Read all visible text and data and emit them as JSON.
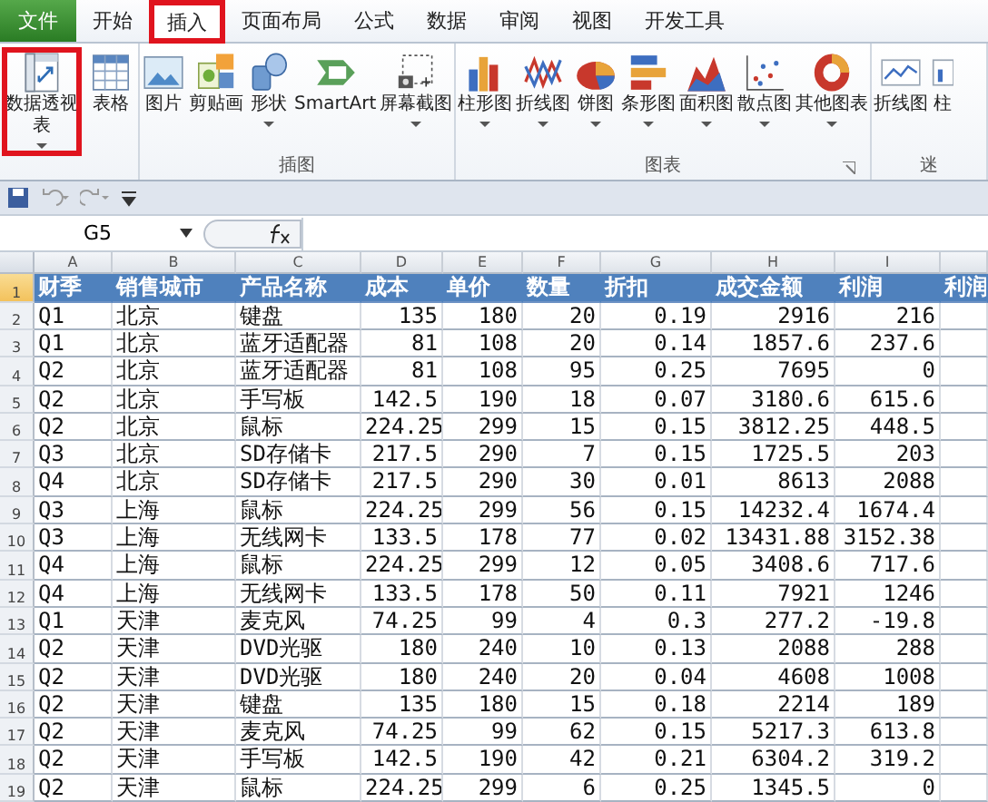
{
  "ribbon_tabs": [
    {
      "label": "文件",
      "kind": "file",
      "selected": false,
      "highlighted": false
    },
    {
      "label": "开始",
      "kind": "tab",
      "selected": false,
      "highlighted": false
    },
    {
      "label": "插入",
      "kind": "tab",
      "selected": true,
      "highlighted": true
    },
    {
      "label": "页面布局",
      "kind": "tab",
      "selected": false,
      "highlighted": false
    },
    {
      "label": "公式",
      "kind": "tab",
      "selected": false,
      "highlighted": false
    },
    {
      "label": "数据",
      "kind": "tab",
      "selected": false,
      "highlighted": false
    },
    {
      "label": "审阅",
      "kind": "tab",
      "selected": false,
      "highlighted": false
    },
    {
      "label": "视图",
      "kind": "tab",
      "selected": false,
      "highlighted": false
    },
    {
      "label": "开发工具",
      "kind": "tab",
      "selected": false,
      "highlighted": false
    }
  ],
  "ribbon_groups": [
    {
      "buttons": [
        {
          "label": "数据透视表",
          "has_menu": true,
          "highlighted": true
        },
        {
          "label": "表格",
          "has_menu": false,
          "highlighted": false
        }
      ]
    },
    {
      "label": "插图",
      "buttons": [
        {
          "label": "图片",
          "has_menu": false,
          "highlighted": false
        },
        {
          "label": "剪贴画",
          "has_menu": false,
          "highlighted": false
        },
        {
          "label": "形状",
          "has_menu": true,
          "highlighted": false
        },
        {
          "label": "SmartArt",
          "has_menu": false,
          "highlighted": false
        },
        {
          "label": "屏幕截图",
          "has_menu": true,
          "highlighted": false
        }
      ]
    },
    {
      "label": "图表",
      "launcher": true,
      "buttons": [
        {
          "label": "柱形图",
          "has_menu": true,
          "highlighted": false
        },
        {
          "label": "折线图",
          "has_menu": true,
          "highlighted": false
        },
        {
          "label": "饼图",
          "has_menu": true,
          "highlighted": false
        },
        {
          "label": "条形图",
          "has_menu": true,
          "highlighted": false
        },
        {
          "label": "面积图",
          "has_menu": true,
          "highlighted": false
        },
        {
          "label": "散点图",
          "has_menu": true,
          "highlighted": false
        },
        {
          "label": "其他图表",
          "has_menu": true,
          "highlighted": false
        }
      ]
    },
    {
      "label": "迷",
      "buttons": [
        {
          "label": "折线图",
          "has_menu": false,
          "highlighted": false
        },
        {
          "label": "柱",
          "has_menu": false,
          "highlighted": false
        }
      ]
    }
  ],
  "name_box": "G5",
  "columns": [
    {
      "letter": "A",
      "kind": "text"
    },
    {
      "letter": "B",
      "kind": "text"
    },
    {
      "letter": "C",
      "kind": "text"
    },
    {
      "letter": "D",
      "kind": "number"
    },
    {
      "letter": "E",
      "kind": "number"
    },
    {
      "letter": "F",
      "kind": "number"
    },
    {
      "letter": "G",
      "kind": "number"
    },
    {
      "letter": "H",
      "kind": "number"
    },
    {
      "letter": "I",
      "kind": "number"
    },
    {
      "kind": "number"
    }
  ],
  "rows": [
    {
      "number": "1",
      "selected": true,
      "header": true,
      "cells": [
        "财季",
        "销售城市",
        "产品名称",
        "成本",
        "单价",
        "数量",
        "折扣",
        "成交金额",
        "利润",
        "利润"
      ]
    },
    {
      "number": "2",
      "selected": false,
      "header": false,
      "cells": [
        "Q1",
        "北京",
        "键盘",
        "135",
        "180",
        "20",
        "0.19",
        "2916",
        "216"
      ]
    },
    {
      "number": "3",
      "selected": false,
      "header": false,
      "cells": [
        "Q1",
        "北京",
        "蓝牙适配器",
        "81",
        "108",
        "20",
        "0.14",
        "1857.6",
        "237.6"
      ]
    },
    {
      "number": "4",
      "selected": false,
      "header": false,
      "cells": [
        "Q2",
        "北京",
        "蓝牙适配器",
        "81",
        "108",
        "95",
        "0.25",
        "7695",
        "0"
      ]
    },
    {
      "number": "5",
      "selected": false,
      "header": false,
      "cells": [
        "Q2",
        "北京",
        "手写板",
        "142.5",
        "190",
        "18",
        "0.07",
        "3180.6",
        "615.6"
      ]
    },
    {
      "number": "6",
      "selected": false,
      "header": false,
      "cells": [
        "Q2",
        "北京",
        "鼠标",
        "224.25",
        "299",
        "15",
        "0.15",
        "3812.25",
        "448.5"
      ]
    },
    {
      "number": "7",
      "selected": false,
      "header": false,
      "cells": [
        "Q3",
        "北京",
        "SD存储卡",
        "217.5",
        "290",
        "7",
        "0.15",
        "1725.5",
        "203"
      ]
    },
    {
      "number": "8",
      "selected": false,
      "header": false,
      "cells": [
        "Q4",
        "北京",
        "SD存储卡",
        "217.5",
        "290",
        "30",
        "0.01",
        "8613",
        "2088"
      ]
    },
    {
      "number": "9",
      "selected": false,
      "header": false,
      "cells": [
        "Q3",
        "上海",
        "鼠标",
        "224.25",
        "299",
        "56",
        "0.15",
        "14232.4",
        "1674.4"
      ]
    },
    {
      "number": "10",
      "selected": false,
      "header": false,
      "cells": [
        "Q3",
        "上海",
        "无线网卡",
        "133.5",
        "178",
        "77",
        "0.02",
        "13431.88",
        "3152.38"
      ]
    },
    {
      "number": "11",
      "selected": false,
      "header": false,
      "cells": [
        "Q4",
        "上海",
        "鼠标",
        "224.25",
        "299",
        "12",
        "0.05",
        "3408.6",
        "717.6"
      ]
    },
    {
      "number": "12",
      "selected": false,
      "header": false,
      "cells": [
        "Q4",
        "上海",
        "无线网卡",
        "133.5",
        "178",
        "50",
        "0.11",
        "7921",
        "1246"
      ]
    },
    {
      "number": "13",
      "selected": false,
      "header": false,
      "cells": [
        "Q1",
        "天津",
        "麦克风",
        "74.25",
        "99",
        "4",
        "0.3",
        "277.2",
        "-19.8"
      ]
    },
    {
      "number": "14",
      "selected": false,
      "header": false,
      "cells": [
        "Q2",
        "天津",
        "DVD光驱",
        "180",
        "240",
        "10",
        "0.13",
        "2088",
        "288"
      ]
    },
    {
      "number": "15",
      "selected": false,
      "header": false,
      "cells": [
        "Q2",
        "天津",
        "DVD光驱",
        "180",
        "240",
        "20",
        "0.04",
        "4608",
        "1008"
      ]
    },
    {
      "number": "16",
      "selected": false,
      "header": false,
      "cells": [
        "Q2",
        "天津",
        "键盘",
        "135",
        "180",
        "15",
        "0.18",
        "2214",
        "189"
      ]
    },
    {
      "number": "17",
      "selected": false,
      "header": false,
      "cells": [
        "Q2",
        "天津",
        "麦克风",
        "74.25",
        "99",
        "62",
        "0.15",
        "5217.3",
        "613.8"
      ]
    },
    {
      "number": "18",
      "selected": false,
      "header": false,
      "cells": [
        "Q2",
        "天津",
        "手写板",
        "142.5",
        "190",
        "42",
        "0.21",
        "6304.2",
        "319.2"
      ]
    },
    {
      "number": "19",
      "selected": false,
      "header": false,
      "cells": [
        "Q2",
        "天津",
        "鼠标",
        "224.25",
        "299",
        "6",
        "0.25",
        "1345.5",
        "0"
      ]
    }
  ]
}
